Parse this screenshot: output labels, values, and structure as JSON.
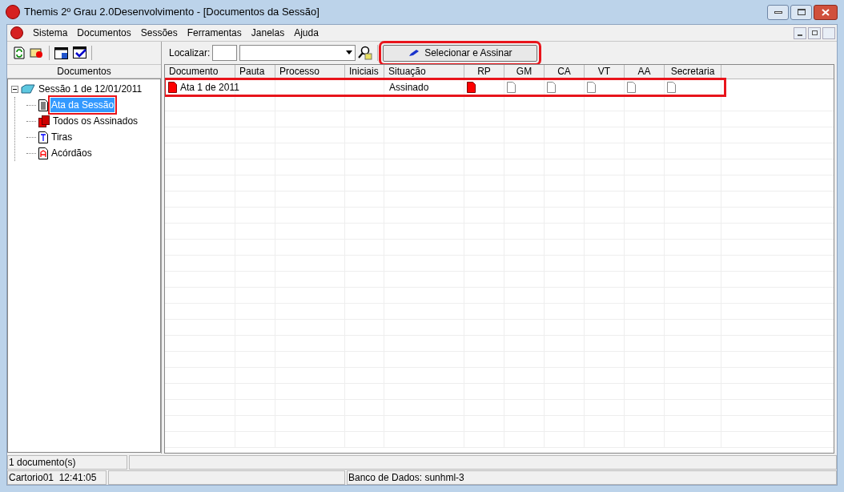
{
  "window": {
    "title": "Themis 2º Grau 2.0Desenvolvimento - [Documentos da Sessão]"
  },
  "menu": [
    "Sistema",
    "Documentos",
    "Sessões",
    "Ferramentas",
    "Janelas",
    "Ajuda"
  ],
  "left_panel": {
    "title": "Documentos",
    "tree": [
      {
        "label": "Sessão 1 de 12/01/2011",
        "kind": "session",
        "expanded": true,
        "selected": false,
        "highlighted": false,
        "children": [
          {
            "label": "Ata da Sessão",
            "kind": "page",
            "selected": true,
            "highlighted": true
          },
          {
            "label": "Todos os Assinados",
            "kind": "signed",
            "selected": false,
            "highlighted": false
          },
          {
            "label": "Tiras",
            "kind": "letter-t",
            "selected": false,
            "highlighted": false
          },
          {
            "label": "Acórdãos",
            "kind": "letter-a",
            "selected": false,
            "highlighted": false
          }
        ]
      }
    ]
  },
  "toolbar": {
    "search_label": "Localizar:",
    "sign_button": {
      "label": "Selecionar e Assinar",
      "highlighted": true
    }
  },
  "table": {
    "columns": [
      "Documento",
      "Pauta",
      "Processo",
      "Iniciais",
      "Situação",
      "RP",
      "GM",
      "CA",
      "VT",
      "AA",
      "Secretaria"
    ],
    "rows": [
      {
        "documento": "Ata 1 de 2011",
        "situacao": "Assinado",
        "highlighted": true,
        "signatures": [
          {
            "signed": true
          },
          {
            "signed": false
          },
          {
            "signed": false
          },
          {
            "signed": false
          },
          {
            "signed": false
          },
          {
            "signed": false
          }
        ]
      }
    ]
  },
  "status_bar": {
    "count": "1 documento(s)",
    "user_time": "Cartorio01  12:41:05",
    "database": "Banco de Dados: sunhml-3"
  }
}
